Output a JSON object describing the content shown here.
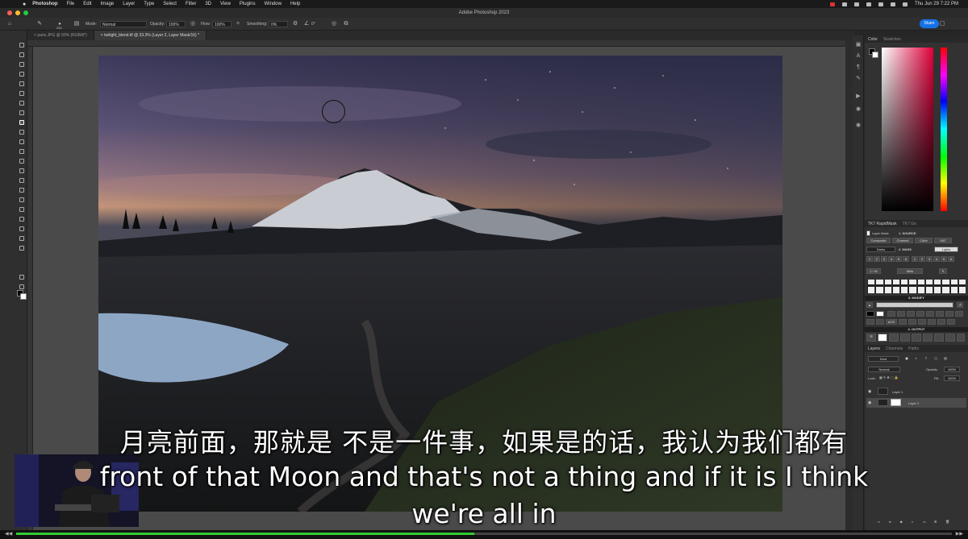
{
  "menubar": {
    "items": [
      "Photoshop",
      "File",
      "Edit",
      "Image",
      "Layer",
      "Type",
      "Select",
      "Filter",
      "3D",
      "View",
      "Plugins",
      "Window",
      "Help"
    ],
    "datetime": "Thu Jun 29  7:22 PM"
  },
  "window": {
    "title": "Adobe Photoshop 2023"
  },
  "options": {
    "brush_size": "250",
    "mode_label": "Mode:",
    "mode_value": "Normal",
    "opacity_label": "Opacity:",
    "opacity_value": "100%",
    "flow_label": "Flow:",
    "flow_value": "100%",
    "smoothing_label": "Smoothing:",
    "smoothing_value": "0%",
    "angle_value": "0°",
    "share_label": "Share"
  },
  "tabs": [
    {
      "label": "paris.JPG @ 50% (RGB/8*)"
    },
    {
      "label": "twilight_blend.tif @ 33.3% (Layer 2, Layer Mask/16) *"
    }
  ],
  "panels": {
    "color": {
      "tab1": "Color",
      "tab2": "Swatches"
    },
    "rapidmask": {
      "tab1": "TK7 RapidMask",
      "tab2": "TK7 Go",
      "layer_mask": "Layer Mask",
      "source": "1. SOURCE",
      "buttons1": [
        "Composite",
        "Channel",
        "Color",
        "SAT"
      ],
      "mask": "2. MASK",
      "darks": "Darks",
      "lights": "Lights",
      "numbers": [
        "1",
        "2",
        "3",
        "4",
        "5",
        "6",
        "1",
        "2",
        "3",
        "4",
        "5",
        "6"
      ],
      "im": "1 / M",
      "mids": "Mids",
      "modify": "3. MODIFY",
      "acr": "ACR",
      "output": "4. OUTPUT"
    },
    "layers": {
      "tab1": "Layers",
      "tab2": "Channels",
      "tab3": "Paths",
      "kind": "Kind",
      "blend": "Normal",
      "opacity_label": "Opacity:",
      "opacity": "100%",
      "lock_label": "Lock:",
      "fill_label": "Fill:",
      "fill": "100%",
      "items": [
        {
          "name": "Layer 1"
        },
        {
          "name": "Layer 2"
        }
      ]
    }
  },
  "subtitles": {
    "line1": "月亮前面，那就是 不是一件事，如果是的话，我认为我们都有",
    "line2": "front of that Moon and that's not a thing and if it is I think",
    "line3": "we're all in"
  },
  "player": {
    "progress": 0.49
  },
  "colors": {
    "accent": "#1473e6",
    "progress": "#33cc33"
  }
}
